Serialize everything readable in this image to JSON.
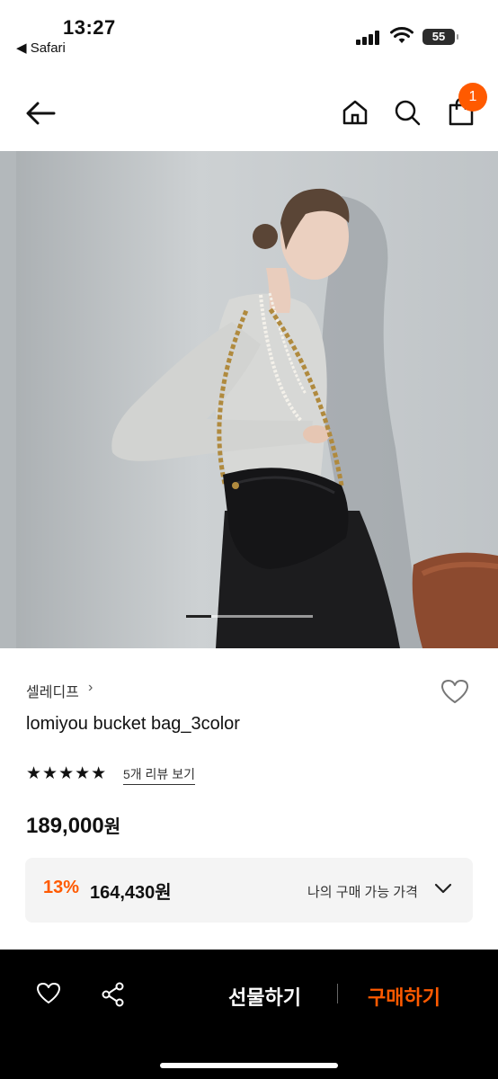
{
  "status_bar": {
    "time": "13:27",
    "back_app": "◀ Safari",
    "battery": "55"
  },
  "nav": {
    "cart_count": "1",
    "icons": [
      "back-arrow-icon",
      "home-icon",
      "search-icon",
      "shopping-bag-icon"
    ]
  },
  "gallery": {
    "current_index": 1,
    "image_count": 5
  },
  "product": {
    "brand": "셀레디프",
    "brand_chevron": "›",
    "name": "lomiyou bucket bag_3color",
    "stars": "★★★★★",
    "rating": 5,
    "reviews_link": "5개 리뷰 보기",
    "price": "189,000",
    "price_unit": "원"
  },
  "discount": {
    "rate": "13%",
    "price": "164,430원",
    "my_price_label": "나의 구매 가능 가격"
  },
  "bottom_bar": {
    "gift_label": "선물하기",
    "buy_label": "구매하기"
  },
  "colors": {
    "accent": "#ff5a00",
    "bottom_bg": "#000000",
    "discount_bg": "#f4f4f4"
  }
}
